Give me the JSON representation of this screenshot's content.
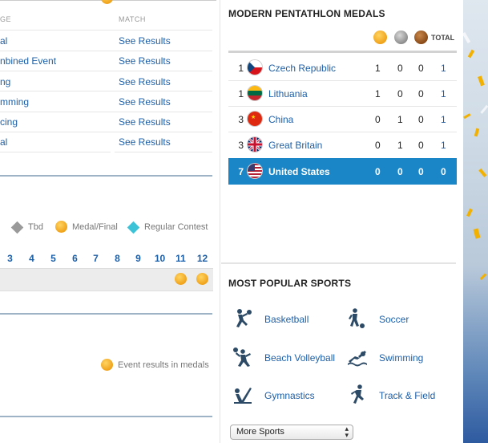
{
  "schedule": {
    "col_stage": "GE",
    "col_match": "MATCH",
    "rows": [
      {
        "stage": "al",
        "link": "See Results"
      },
      {
        "stage": "nbined Event",
        "link": "See Results"
      },
      {
        "stage": "ng",
        "link": "See Results"
      },
      {
        "stage": "mming",
        "link": "See Results"
      },
      {
        "stage": "cing",
        "link": "See Results"
      },
      {
        "stage": "al",
        "link": "See Results"
      }
    ]
  },
  "legend": {
    "tbd": "Tbd",
    "medal_final": "Medal/Final",
    "regular": "Regular Contest"
  },
  "days": [
    "3",
    "4",
    "5",
    "6",
    "7",
    "8",
    "9",
    "10",
    "11",
    "12"
  ],
  "event_results_note": "Event results in medals",
  "medals": {
    "title": "MODERN PENTATHLON MEDALS",
    "total_label": "TOTAL",
    "rows": [
      {
        "rank": "1",
        "country": "Czech Republic",
        "gold": "1",
        "silver": "0",
        "bronze": "0",
        "total": "1"
      },
      {
        "rank": "1",
        "country": "Lithuania",
        "gold": "1",
        "silver": "0",
        "bronze": "0",
        "total": "1"
      },
      {
        "rank": "3",
        "country": "China",
        "gold": "0",
        "silver": "1",
        "bronze": "0",
        "total": "1"
      },
      {
        "rank": "3",
        "country": "Great Britain",
        "gold": "0",
        "silver": "1",
        "bronze": "0",
        "total": "1"
      },
      {
        "rank": "7",
        "country": "United States",
        "gold": "0",
        "silver": "0",
        "bronze": "0",
        "total": "0"
      }
    ]
  },
  "popular": {
    "title": "MOST POPULAR SPORTS",
    "sports": [
      "Basketball",
      "Soccer",
      "Beach Volleyball",
      "Swimming",
      "Gymnastics",
      "Track & Field"
    ],
    "select_value": "More Sports"
  },
  "colors": {
    "accent": "#1a86c8",
    "link": "#1d5fa7"
  }
}
